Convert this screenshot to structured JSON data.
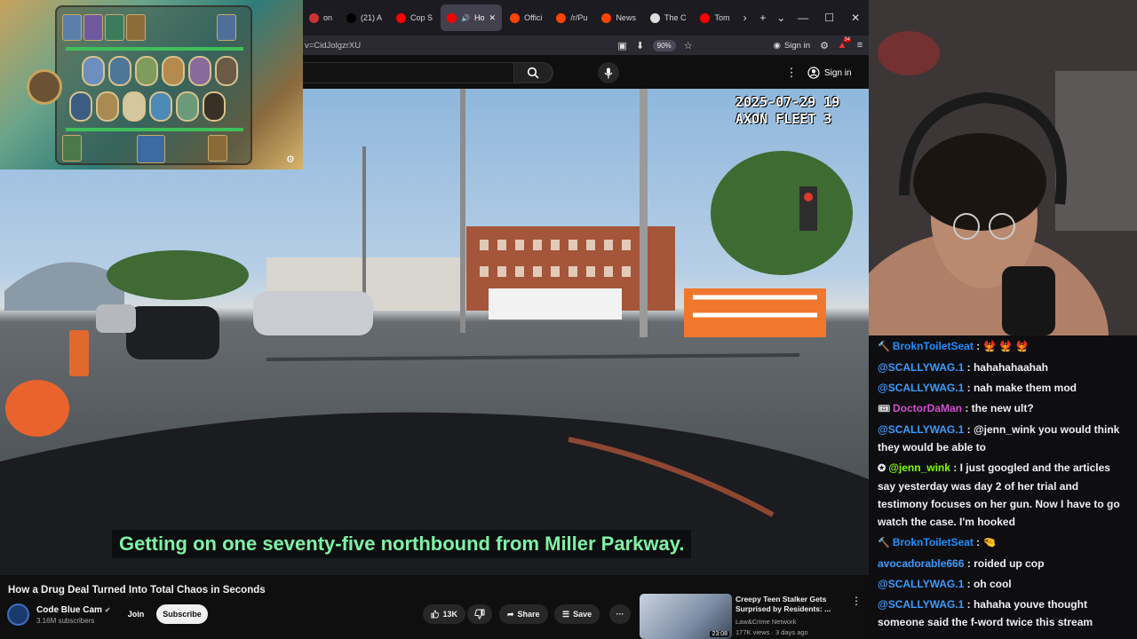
{
  "browser": {
    "tabs": [
      {
        "label": "on",
        "favicon_color": "#c33",
        "active": false
      },
      {
        "label": "(21) A",
        "favicon_color": "#000",
        "active": false,
        "icon": "x-icon"
      },
      {
        "label": "Cop S",
        "favicon_color": "#f00",
        "active": false
      },
      {
        "label": "Ho",
        "favicon_color": "#f00",
        "active": true
      },
      {
        "label": "Offici",
        "favicon_color": "#ff4500",
        "active": false
      },
      {
        "label": "/r/Pu",
        "favicon_color": "#ff4500",
        "active": false
      },
      {
        "label": "News",
        "favicon_color": "#ff4500",
        "active": false
      },
      {
        "label": "The C",
        "favicon_color": "#ddd",
        "active": false,
        "icon": "wikipedia-icon"
      },
      {
        "label": "Tom",
        "favicon_color": "#f00",
        "active": false
      }
    ],
    "url": "v=CidJolgzrXU",
    "zoom": "90%",
    "sign_in": "Sign in",
    "extension_badge": "34"
  },
  "youtube": {
    "header_sign_in": "Sign in",
    "video": {
      "title": "How a Drug Deal Turned Into Total Chaos in Seconds",
      "subtitle": "Getting on one seventy-five northbound from Miller Parkway.",
      "timestamp_line1": "2025-07-29 19",
      "timestamp_line2": "AXON FLEET 3"
    },
    "channel": {
      "name": "Code Blue Cam",
      "subscribers": "3.16M subscribers",
      "join_label": "Join",
      "subscribe_label": "Subscribe"
    },
    "actions": {
      "likes": "13K",
      "share": "Share",
      "save": "Save"
    },
    "recommended": {
      "title": "Creepy Teen Stalker Gets Surprised by Residents: ...",
      "channel": "Law&Crime Network",
      "meta": "177K views · 3 days ago",
      "duration": "23:08"
    }
  },
  "chat": [
    {
      "badge": "🔨",
      "user": "BroknToiletSeat",
      "color": "#1e90ff",
      "text": "🐦‍🔥 🐦‍🔥 🐦‍🔥"
    },
    {
      "badge": "",
      "user": "@SCALLYWAG.1",
      "color": "#3d9bff",
      "text": "hahahahaahah"
    },
    {
      "badge": "",
      "user": "@SCALLYWAG.1",
      "color": "#3d9bff",
      "text": "nah make them mod"
    },
    {
      "badge": "🎟",
      "user": "DoctorDaMan",
      "color": "#d14fd1",
      "text": "the new ult?"
    },
    {
      "badge": "",
      "user": "@SCALLYWAG.1",
      "color": "#3d9bff",
      "text": "@jenn_wink you would think they would be able to"
    },
    {
      "badge": "✪",
      "user": "@jenn_wink",
      "color": "#7fff00",
      "text": "I just googled and the articles say yesterday was day 2 of her trial and testimony focuses on her gun. Now I have to go watch the case. I'm hooked"
    },
    {
      "badge": "🔨",
      "user": "BroknToiletSeat",
      "color": "#1e90ff",
      "text": "🤏"
    },
    {
      "badge": "",
      "user": "avocadorable666",
      "color": "#3d9bff",
      "text": "roided up cop"
    },
    {
      "badge": "",
      "user": "@SCALLYWAG.1",
      "color": "#3d9bff",
      "text": "oh cool"
    },
    {
      "badge": "",
      "user": "@SCALLYWAG.1",
      "color": "#3d9bff",
      "text": "hahaha youve thought someone said the f-word twice this stream"
    }
  ]
}
